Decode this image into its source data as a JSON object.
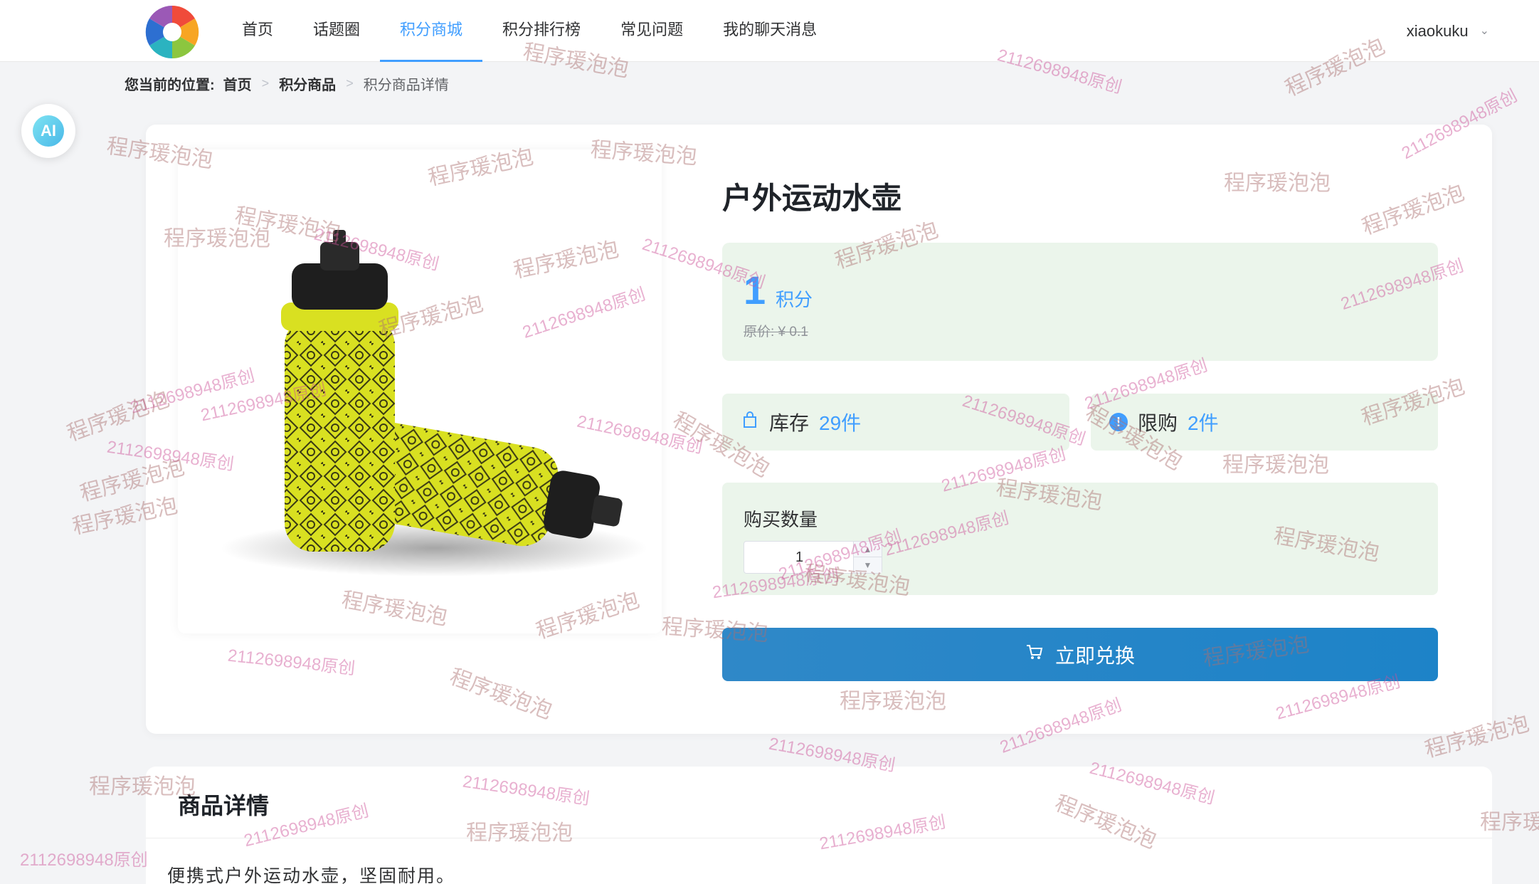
{
  "nav": {
    "items": [
      "首页",
      "话题圈",
      "积分商城",
      "积分排行榜",
      "常见问题",
      "我的聊天消息"
    ],
    "active_index": 2,
    "user": "xiaokuku"
  },
  "breadcrumb": {
    "prefix": "您当前的位置:",
    "home": "首页",
    "section": "积分商品",
    "current": "积分商品详情"
  },
  "ai_button": "AI",
  "product": {
    "title": "户外运动水壶",
    "price": "1",
    "price_unit": "积分",
    "original_price": "原价: ¥ 0.1",
    "stock_label": "库存",
    "stock_value": "29件",
    "limit_label": "限购",
    "limit_value": "2件",
    "quantity_label": "购买数量",
    "quantity_value": "1",
    "redeem_label": "立即兑换"
  },
  "detail": {
    "title": "商品详情",
    "text": "便携式户外运动水壶，坚固耐用。"
  },
  "watermark": {
    "text_a": "程序瑗泡泡",
    "text_b": "2112698948原创"
  },
  "colors": {
    "accent": "#409eff",
    "panel_green": "#ebf5eb",
    "button_blue": "#1d83c8"
  }
}
